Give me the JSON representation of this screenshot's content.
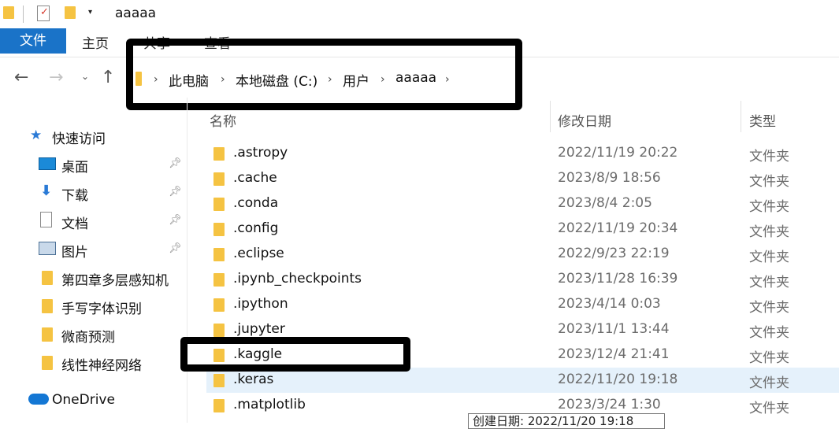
{
  "window": {
    "title": "aaaaa"
  },
  "ribbon": {
    "tabs": [
      "文件",
      "主页",
      "共享",
      "查看"
    ]
  },
  "address": {
    "crumbs": [
      "此电脑",
      "本地磁盘 (C:)",
      "用户",
      "aaaaa"
    ]
  },
  "sidebar": {
    "quick_access": "快速访问",
    "items": [
      {
        "label": "桌面",
        "icon": "desktop-icon",
        "pinned": true
      },
      {
        "label": "下载",
        "icon": "download-icon",
        "pinned": true
      },
      {
        "label": "文档",
        "icon": "document-icon",
        "pinned": true
      },
      {
        "label": "图片",
        "icon": "picture-icon",
        "pinned": true
      },
      {
        "label": "第四章多层感知机",
        "icon": "folder-icon",
        "pinned": false
      },
      {
        "label": "手写字体识别",
        "icon": "folder-icon",
        "pinned": false
      },
      {
        "label": "微商预测",
        "icon": "folder-icon",
        "pinned": false
      },
      {
        "label": "线性神经网络",
        "icon": "folder-icon",
        "pinned": false
      }
    ],
    "onedrive": "OneDrive"
  },
  "columns": {
    "name": "名称",
    "date": "修改日期",
    "type": "类型"
  },
  "files": [
    {
      "name": ".astropy",
      "date": "2022/11/19 20:22",
      "type": "文件夹"
    },
    {
      "name": ".cache",
      "date": "2023/8/9 18:56",
      "type": "文件夹"
    },
    {
      "name": ".conda",
      "date": "2023/8/4 2:05",
      "type": "文件夹"
    },
    {
      "name": ".config",
      "date": "2022/11/19 20:34",
      "type": "文件夹"
    },
    {
      "name": ".eclipse",
      "date": "2022/9/23 22:19",
      "type": "文件夹"
    },
    {
      "name": ".ipynb_checkpoints",
      "date": "2023/11/28 16:39",
      "type": "文件夹"
    },
    {
      "name": ".ipython",
      "date": "2023/4/14 0:03",
      "type": "文件夹"
    },
    {
      "name": ".jupyter",
      "date": "2023/11/1 13:44",
      "type": "文件夹"
    },
    {
      "name": ".kaggle",
      "date": "2023/12/4 21:41",
      "type": "文件夹"
    },
    {
      "name": ".keras",
      "date": "2022/11/20 19:18",
      "type": "文件夹",
      "selected": true
    },
    {
      "name": ".matplotlib",
      "date": "2023/3/24 1:30",
      "type": "文件夹"
    }
  ],
  "tooltip": "创建日期: 2022/11/20 19:18",
  "colors": {
    "accent": "#1a73c8",
    "folder": "#f5c342",
    "selected_row": "#e5f1fb"
  }
}
